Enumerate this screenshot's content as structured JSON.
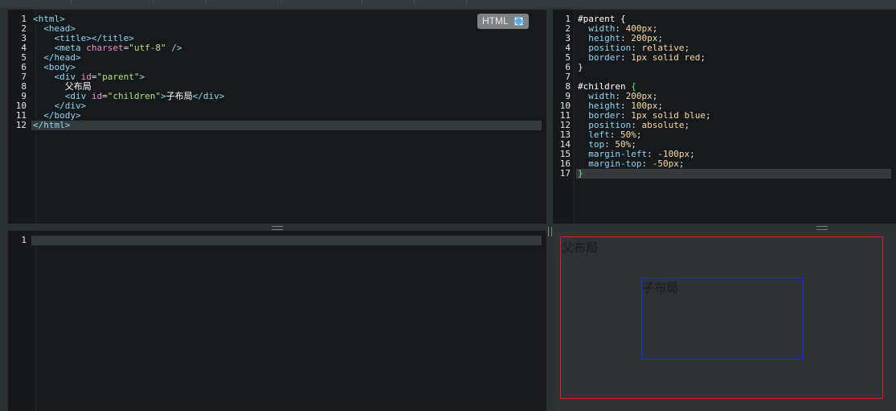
{
  "html_editor": {
    "badge_label": "HTML",
    "badge_icon": "expand-icon",
    "lines": [
      {
        "n": "1",
        "tokens": [
          {
            "c": "t-tag",
            "t": "<html>"
          }
        ]
      },
      {
        "n": "2",
        "tokens": [
          {
            "c": "t-pun",
            "t": "  "
          },
          {
            "c": "t-tag",
            "t": "<head>"
          }
        ]
      },
      {
        "n": "3",
        "tokens": [
          {
            "c": "t-pun",
            "t": "    "
          },
          {
            "c": "t-tag",
            "t": "<title></title>"
          }
        ]
      },
      {
        "n": "4",
        "tokens": [
          {
            "c": "t-pun",
            "t": "    "
          },
          {
            "c": "t-tag",
            "t": "<meta "
          },
          {
            "c": "t-attr",
            "t": "charset"
          },
          {
            "c": "t-pun",
            "t": "="
          },
          {
            "c": "t-str",
            "t": "\"utf-8\""
          },
          {
            "c": "t-tag",
            "t": " />"
          }
        ]
      },
      {
        "n": "5",
        "tokens": [
          {
            "c": "t-pun",
            "t": "  "
          },
          {
            "c": "t-tag",
            "t": "</head>"
          }
        ]
      },
      {
        "n": "6",
        "tokens": [
          {
            "c": "t-pun",
            "t": "  "
          },
          {
            "c": "t-tag",
            "t": "<body>"
          }
        ]
      },
      {
        "n": "7",
        "tokens": [
          {
            "c": "t-pun",
            "t": "    "
          },
          {
            "c": "t-tag",
            "t": "<div "
          },
          {
            "c": "t-attr",
            "t": "id"
          },
          {
            "c": "t-pun",
            "t": "="
          },
          {
            "c": "t-str",
            "t": "\"parent\""
          },
          {
            "c": "t-tag",
            "t": ">"
          }
        ]
      },
      {
        "n": "8",
        "tokens": [
          {
            "c": "t-pun",
            "t": "      "
          },
          {
            "c": "t-txt",
            "t": "父布局"
          }
        ]
      },
      {
        "n": "9",
        "tokens": [
          {
            "c": "t-pun",
            "t": "      "
          },
          {
            "c": "t-tag",
            "t": "<div "
          },
          {
            "c": "t-attr",
            "t": "id"
          },
          {
            "c": "t-pun",
            "t": "="
          },
          {
            "c": "t-str",
            "t": "\"children\""
          },
          {
            "c": "t-tag",
            "t": ">"
          },
          {
            "c": "t-txt",
            "t": "子布局"
          },
          {
            "c": "t-tag",
            "t": "</div>"
          }
        ]
      },
      {
        "n": "10",
        "tokens": [
          {
            "c": "t-pun",
            "t": "    "
          },
          {
            "c": "t-tag",
            "t": "</div>"
          }
        ]
      },
      {
        "n": "11",
        "tokens": [
          {
            "c": "t-pun",
            "t": "  "
          },
          {
            "c": "t-tag",
            "t": "</body>"
          }
        ]
      },
      {
        "n": "12",
        "active": true,
        "tokens": [
          {
            "c": "t-tag",
            "t": "</html>"
          }
        ]
      }
    ]
  },
  "css_editor": {
    "lines": [
      {
        "n": "1",
        "tokens": [
          {
            "c": "t-sel",
            "t": "#parent {"
          }
        ]
      },
      {
        "n": "2",
        "tokens": [
          {
            "c": "t-pun",
            "t": "  "
          },
          {
            "c": "t-prop",
            "t": "width"
          },
          {
            "c": "t-pun",
            "t": ": "
          },
          {
            "c": "t-val",
            "t": "400px"
          },
          {
            "c": "t-pun",
            "t": ";"
          }
        ]
      },
      {
        "n": "3",
        "tokens": [
          {
            "c": "t-pun",
            "t": "  "
          },
          {
            "c": "t-prop",
            "t": "height"
          },
          {
            "c": "t-pun",
            "t": ": "
          },
          {
            "c": "t-val",
            "t": "200px"
          },
          {
            "c": "t-pun",
            "t": ";"
          }
        ]
      },
      {
        "n": "4",
        "tokens": [
          {
            "c": "t-pun",
            "t": "  "
          },
          {
            "c": "t-prop",
            "t": "position"
          },
          {
            "c": "t-pun",
            "t": ": "
          },
          {
            "c": "t-val",
            "t": "relative"
          },
          {
            "c": "t-pun",
            "t": ";"
          }
        ]
      },
      {
        "n": "5",
        "tokens": [
          {
            "c": "t-pun",
            "t": "  "
          },
          {
            "c": "t-prop",
            "t": "border"
          },
          {
            "c": "t-pun",
            "t": ": "
          },
          {
            "c": "t-val",
            "t": "1px solid red"
          },
          {
            "c": "t-pun",
            "t": ";"
          }
        ]
      },
      {
        "n": "6",
        "tokens": [
          {
            "c": "t-pun",
            "t": "}"
          }
        ]
      },
      {
        "n": "7",
        "tokens": []
      },
      {
        "n": "8",
        "tokens": [
          {
            "c": "t-sel",
            "t": "#children "
          },
          {
            "c": "t-brace-g",
            "t": "{"
          }
        ]
      },
      {
        "n": "9",
        "tokens": [
          {
            "c": "t-pun",
            "t": "  "
          },
          {
            "c": "t-prop",
            "t": "width"
          },
          {
            "c": "t-pun",
            "t": ": "
          },
          {
            "c": "t-val",
            "t": "200px"
          },
          {
            "c": "t-pun",
            "t": ";"
          }
        ]
      },
      {
        "n": "10",
        "tokens": [
          {
            "c": "t-pun",
            "t": "  "
          },
          {
            "c": "t-prop",
            "t": "height"
          },
          {
            "c": "t-pun",
            "t": ": "
          },
          {
            "c": "t-val",
            "t": "100px"
          },
          {
            "c": "t-pun",
            "t": ";"
          }
        ]
      },
      {
        "n": "11",
        "tokens": [
          {
            "c": "t-pun",
            "t": "  "
          },
          {
            "c": "t-prop",
            "t": "border"
          },
          {
            "c": "t-pun",
            "t": ": "
          },
          {
            "c": "t-val",
            "t": "1px solid blue"
          },
          {
            "c": "t-pun",
            "t": ";"
          }
        ]
      },
      {
        "n": "12",
        "tokens": [
          {
            "c": "t-pun",
            "t": "  "
          },
          {
            "c": "t-prop",
            "t": "position"
          },
          {
            "c": "t-pun",
            "t": ": "
          },
          {
            "c": "t-val",
            "t": "absolute"
          },
          {
            "c": "t-pun",
            "t": ";"
          }
        ]
      },
      {
        "n": "13",
        "tokens": [
          {
            "c": "t-pun",
            "t": "  "
          },
          {
            "c": "t-prop",
            "t": "left"
          },
          {
            "c": "t-pun",
            "t": ": "
          },
          {
            "c": "t-val",
            "t": "50%"
          },
          {
            "c": "t-pun",
            "t": ";"
          }
        ]
      },
      {
        "n": "14",
        "tokens": [
          {
            "c": "t-pun",
            "t": "  "
          },
          {
            "c": "t-prop",
            "t": "top"
          },
          {
            "c": "t-pun",
            "t": ": "
          },
          {
            "c": "t-val",
            "t": "50%"
          },
          {
            "c": "t-pun",
            "t": ";"
          }
        ]
      },
      {
        "n": "15",
        "tokens": [
          {
            "c": "t-pun",
            "t": "  "
          },
          {
            "c": "t-prop",
            "t": "margin-left"
          },
          {
            "c": "t-pun",
            "t": ": "
          },
          {
            "c": "t-val",
            "t": "-100px"
          },
          {
            "c": "t-pun",
            "t": ";"
          }
        ]
      },
      {
        "n": "16",
        "tokens": [
          {
            "c": "t-pun",
            "t": "  "
          },
          {
            "c": "t-prop",
            "t": "margin-top"
          },
          {
            "c": "t-pun",
            "t": ": "
          },
          {
            "c": "t-val",
            "t": "-50px"
          },
          {
            "c": "t-pun",
            "t": ";"
          }
        ]
      },
      {
        "n": "17",
        "active": true,
        "tokens": [
          {
            "c": "t-brace-g",
            "t": "}"
          }
        ]
      }
    ]
  },
  "js_editor": {
    "lines": [
      {
        "n": "1",
        "active": true,
        "tokens": []
      }
    ]
  },
  "preview": {
    "parent_text": "父布局",
    "child_text": "子布局",
    "parent_border_color": "#e31b1b",
    "child_border_color": "#1a2bff"
  }
}
